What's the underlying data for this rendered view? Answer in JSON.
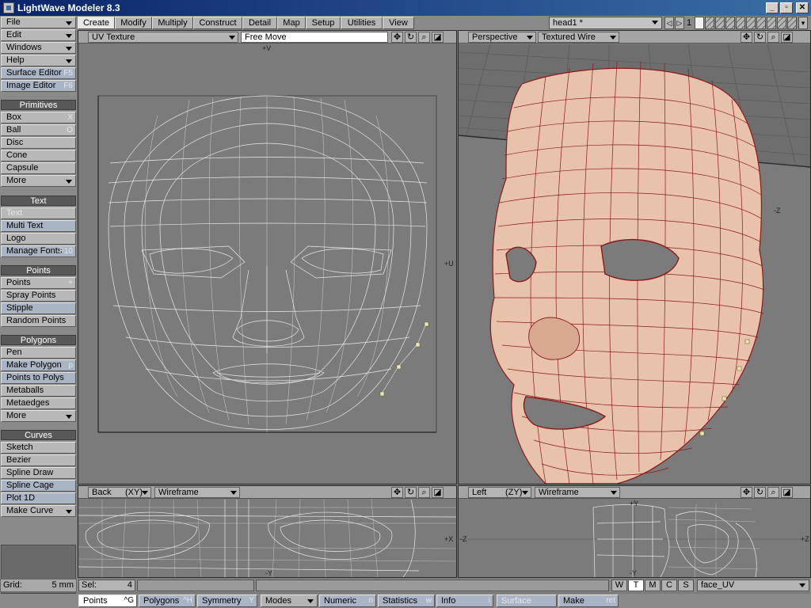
{
  "window": {
    "title": "LightWave Modeler 8.3",
    "minimize": "_",
    "restore": "▫",
    "close": "✕"
  },
  "menus": {
    "file": "File",
    "edit": "Edit",
    "windows": "Windows",
    "help": "Help",
    "surface_editor": "Surface Editor",
    "surface_editor_key": "F5",
    "image_editor": "Image Editor",
    "image_editor_key": "F6"
  },
  "primitives": {
    "header": "Primitives",
    "items": [
      {
        "label": "Box",
        "key": "X"
      },
      {
        "label": "Ball",
        "key": "O"
      },
      {
        "label": "Disc",
        "key": ""
      },
      {
        "label": "Cone",
        "key": ""
      },
      {
        "label": "Capsule",
        "key": ""
      },
      {
        "label": "More",
        "key": ""
      }
    ]
  },
  "text_group": {
    "header": "Text",
    "items": [
      {
        "label": "Text",
        "key": ""
      },
      {
        "label": "Multi Text",
        "key": ""
      },
      {
        "label": "Logo",
        "key": ""
      },
      {
        "label": "Manage Fonts",
        "key": "F10"
      }
    ]
  },
  "points_group": {
    "header": "Points",
    "items": [
      {
        "label": "Points",
        "key": "+"
      },
      {
        "label": "Spray Points",
        "key": ""
      },
      {
        "label": "Stipple",
        "key": ""
      },
      {
        "label": "Random Points",
        "key": ""
      }
    ]
  },
  "polygons_group": {
    "header": "Polygons",
    "items": [
      {
        "label": "Pen",
        "key": ""
      },
      {
        "label": "Make Polygon",
        "key": "p"
      },
      {
        "label": "Points to Polys",
        "key": ""
      },
      {
        "label": "Metaballs",
        "key": ""
      },
      {
        "label": "Metaedges",
        "key": ""
      },
      {
        "label": "More",
        "key": ""
      }
    ]
  },
  "curves_group": {
    "header": "Curves",
    "items": [
      {
        "label": "Sketch",
        "key": ""
      },
      {
        "label": "Bezier",
        "key": ""
      },
      {
        "label": "Spline Draw",
        "key": ""
      },
      {
        "label": "Spline Cage",
        "key": ""
      },
      {
        "label": "Plot 1D",
        "key": ""
      },
      {
        "label": "Make Curve",
        "key": ""
      }
    ]
  },
  "grid": {
    "label": "Grid:",
    "value": "5 mm"
  },
  "tabs": [
    "Create",
    "Modify",
    "Multiply",
    "Construct",
    "Detail",
    "Map",
    "Setup",
    "Utilities",
    "View"
  ],
  "object": {
    "name": "head1 *",
    "layer": "1"
  },
  "viewports": {
    "uv": {
      "mode": "UV Texture",
      "tool": "Free Move",
      "axis_v": "+V",
      "axis_u": "+U"
    },
    "perspective": {
      "view": "Perspective",
      "render": "Textured Wire",
      "axis": "-Z"
    },
    "back": {
      "view": "Back",
      "plane": "(XY)",
      "render": "Wireframe",
      "axis_x": "+X",
      "axis_y": "-Y"
    },
    "left": {
      "view": "Left",
      "plane": "(ZY)",
      "render": "Wireframe",
      "axis_z": "-Z",
      "axis_z2": "+Z",
      "axis_y": "+Y",
      "axis_y2": "-Y"
    }
  },
  "status": {
    "sel_label": "Sel:",
    "sel_value": "4",
    "wtmcs": [
      "W",
      "T",
      "M",
      "C",
      "S"
    ],
    "surface": "face_UV"
  },
  "modes": {
    "points": "Points",
    "points_key": "^G",
    "polygons": "Polygons",
    "polygons_key": "^H",
    "symmetry": "Symmetry",
    "symmetry_key": "Y",
    "modes": "Modes",
    "numeric": "Numeric",
    "numeric_key": "n",
    "statistics": "Statistics",
    "statistics_key": "w",
    "info": "Info",
    "info_key": "i",
    "surface": "Surface",
    "make": "Make",
    "make_key": "ret"
  },
  "colors": {
    "accent": "#0a246a",
    "wire_red": "#8b1a1a",
    "skin": "#e8c2aa"
  }
}
